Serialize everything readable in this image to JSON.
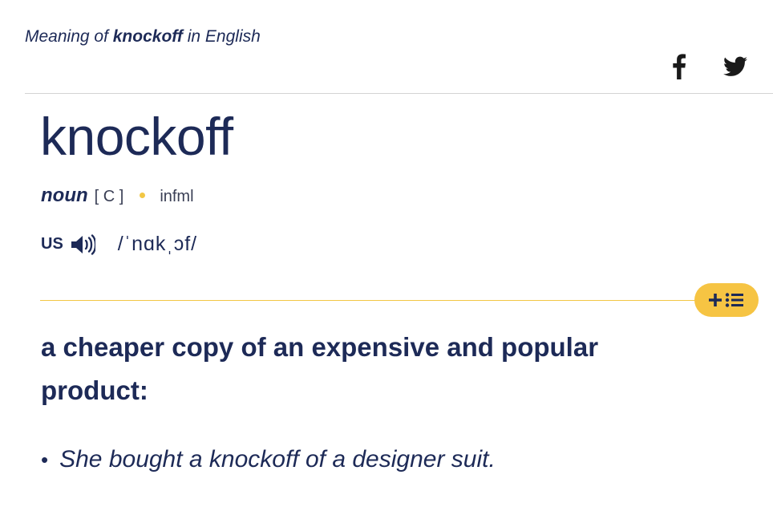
{
  "header": {
    "prefix": "Meaning of",
    "word": "knockoff",
    "suffix": "in English"
  },
  "share": {
    "facebook_icon": "facebook-icon",
    "twitter_icon": "twitter-icon"
  },
  "entry": {
    "headword": "knockoff",
    "part_of_speech": "noun",
    "grammar_code": "[ C ]",
    "register_label": "infml",
    "pronunciation": {
      "region": "US",
      "audio_icon": "speaker-icon",
      "ipa": "/ˈnɑkˌɔf/"
    }
  },
  "sense": {
    "add_to_list_icon": "plus-list-icon",
    "definition": "a cheaper copy of an expensive and popular product:",
    "examples": [
      "She bought a knockoff of a designer suit."
    ]
  },
  "colors": {
    "text": "#1d2a57",
    "accent": "#f2c744",
    "rule": "#d4d4d4"
  }
}
